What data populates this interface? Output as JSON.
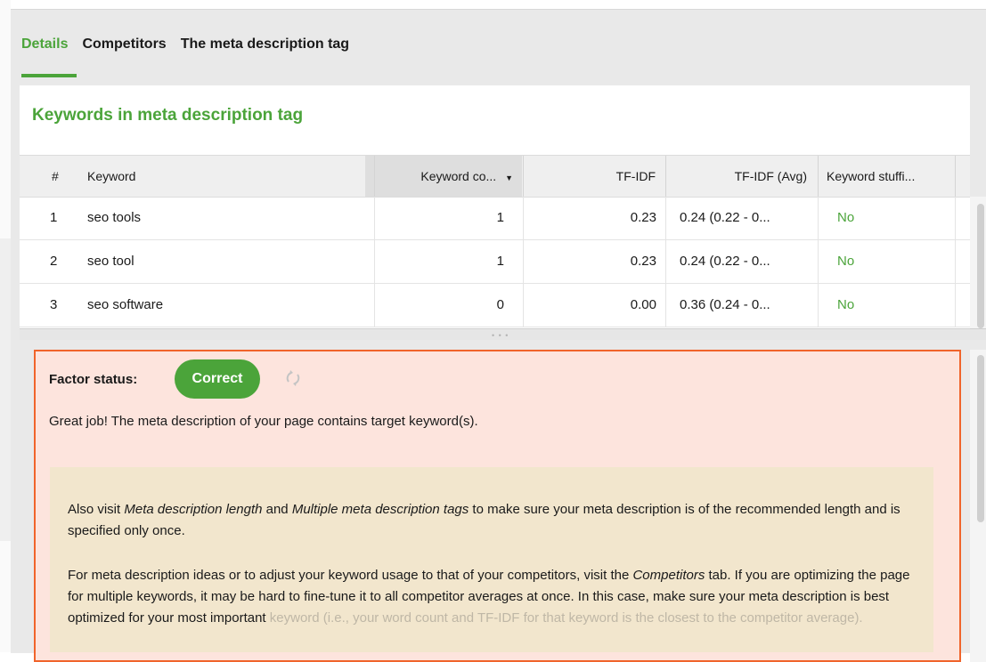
{
  "tabs": [
    {
      "label": "Details",
      "active": true
    },
    {
      "label": "Competitors",
      "active": false
    },
    {
      "label": "The meta description tag",
      "active": false
    }
  ],
  "section_title": "Keywords in meta description tag",
  "table": {
    "headers": [
      "#",
      "Keyword",
      "Keyword co...",
      "TF-IDF",
      "TF-IDF (Avg)",
      "Keyword stuffi..."
    ],
    "sort_indicator": "▼",
    "rows": [
      {
        "num": "1",
        "keyword": "seo tools",
        "count": "1",
        "tfidf": "0.23",
        "tfidf_avg": "0.24 (0.22 - 0...",
        "stuffing": "No"
      },
      {
        "num": "2",
        "keyword": "seo tool",
        "count": "1",
        "tfidf": "0.23",
        "tfidf_avg": "0.24 (0.22 - 0...",
        "stuffing": "No"
      },
      {
        "num": "3",
        "keyword": "seo software",
        "count": "0",
        "tfidf": "0.00",
        "tfidf_avg": "0.36 (0.24 - 0...",
        "stuffing": "No"
      }
    ]
  },
  "factor": {
    "label": "Factor status:",
    "status": "Correct",
    "message": "Great job! The meta description of your page contains target keyword(s).",
    "note_p1": {
      "t1": "Also visit ",
      "link1": "Meta description length",
      "t2": " and ",
      "link2": "Multiple meta description tags",
      "t3": " to make sure your meta description is of the recommended length and is specified only once."
    },
    "note_p2": {
      "t1": "For meta description ideas or to adjust your keyword usage to that of your competitors, visit the ",
      "link": "Competitors",
      "t2": " tab. If you are optimizing the page for multiple keywords, it may be hard to fine-tune it to all competitor averages at once. In this case, make sure your meta description is best optimized for your most important ",
      "t3": "keyword (i.e., your word count and TF-IDF for that keyword is the closest to the competitor average)."
    }
  },
  "colors": {
    "accent": "#4ba43a",
    "alert_border": "#f0642b",
    "alert_bg": "#fde4dd",
    "note_bg": "#f2e6cd"
  }
}
